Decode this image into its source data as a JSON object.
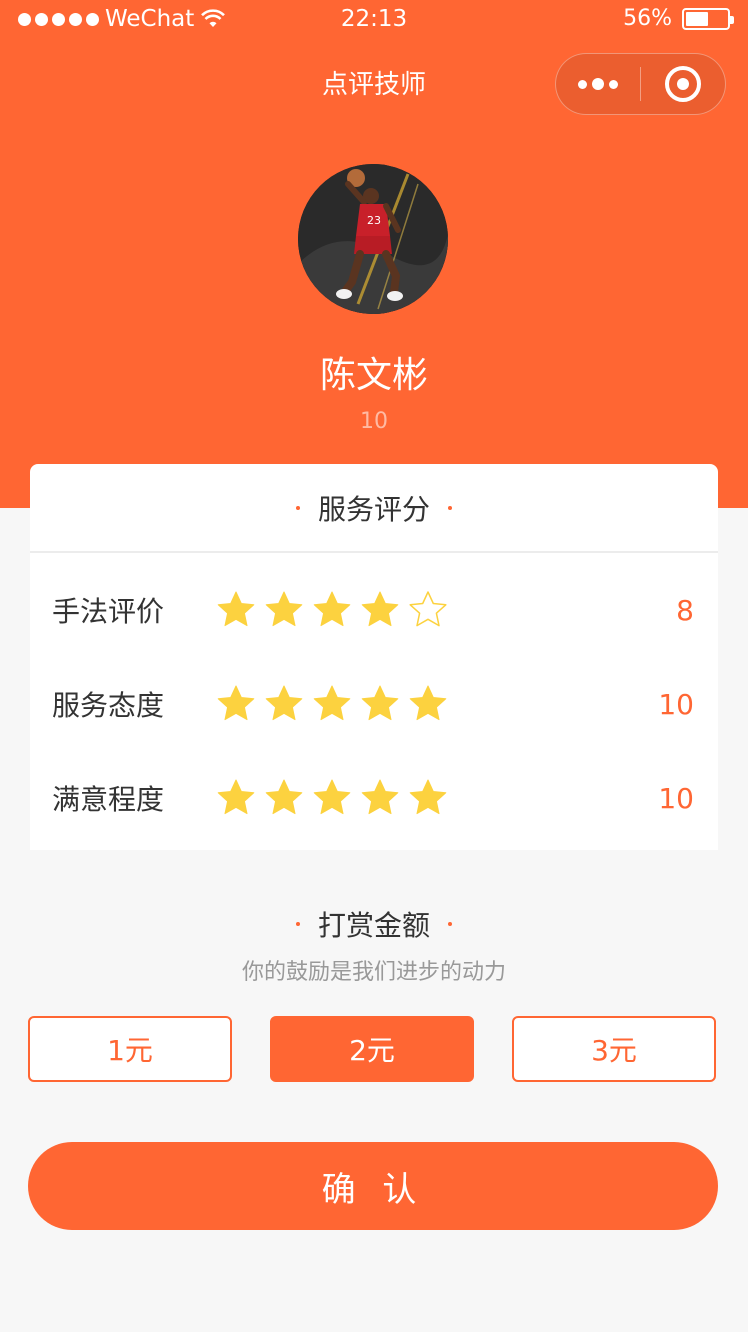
{
  "status_bar": {
    "carrier": "WeChat",
    "time": "22:13",
    "battery": "56%",
    "battery_level": 0.56
  },
  "nav": {
    "title": "点评技师"
  },
  "profile": {
    "name": "陈文彬",
    "sub": "10"
  },
  "rating": {
    "title": "服务评分",
    "items": [
      {
        "label": "手法评价",
        "stars": 4,
        "max": 5,
        "score": "8"
      },
      {
        "label": "服务态度",
        "stars": 5,
        "max": 5,
        "score": "10"
      },
      {
        "label": "满意程度",
        "stars": 5,
        "max": 5,
        "score": "10"
      }
    ]
  },
  "reward": {
    "title": "打赏金额",
    "subtitle": "你的鼓励是我们进步的动力",
    "options": [
      "1元",
      "2元",
      "3元"
    ],
    "selected_index": 1
  },
  "confirm_label": "确 认",
  "colors": {
    "accent": "#ff6633",
    "star": "#fcd23f",
    "background": "#f7f7f7"
  }
}
